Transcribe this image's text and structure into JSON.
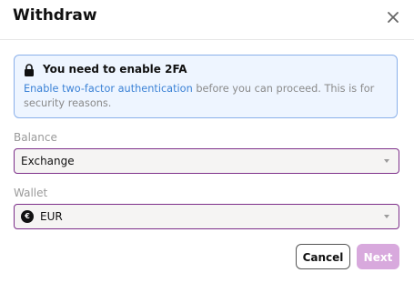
{
  "modal": {
    "title": "Withdraw",
    "close_icon": "close-icon"
  },
  "notice": {
    "icon": "lock-icon",
    "title": "You need to enable 2FA",
    "link_text": "Enable two-factor authentication",
    "body_text": " before you can proceed. This is for security reasons.",
    "bg_color": "#eef5ff",
    "border_color": "#8ab0ea",
    "link_color": "#3b82d6"
  },
  "balance": {
    "label": "Balance",
    "value": "Exchange"
  },
  "wallet": {
    "label": "Wallet",
    "value": "EUR",
    "icon": "euro-icon",
    "icon_glyph": "€"
  },
  "actions": {
    "cancel_label": "Cancel",
    "next_label": "Next"
  },
  "colors": {
    "accent": "#7d2f8a",
    "next_disabled": "#d8a9dd"
  }
}
